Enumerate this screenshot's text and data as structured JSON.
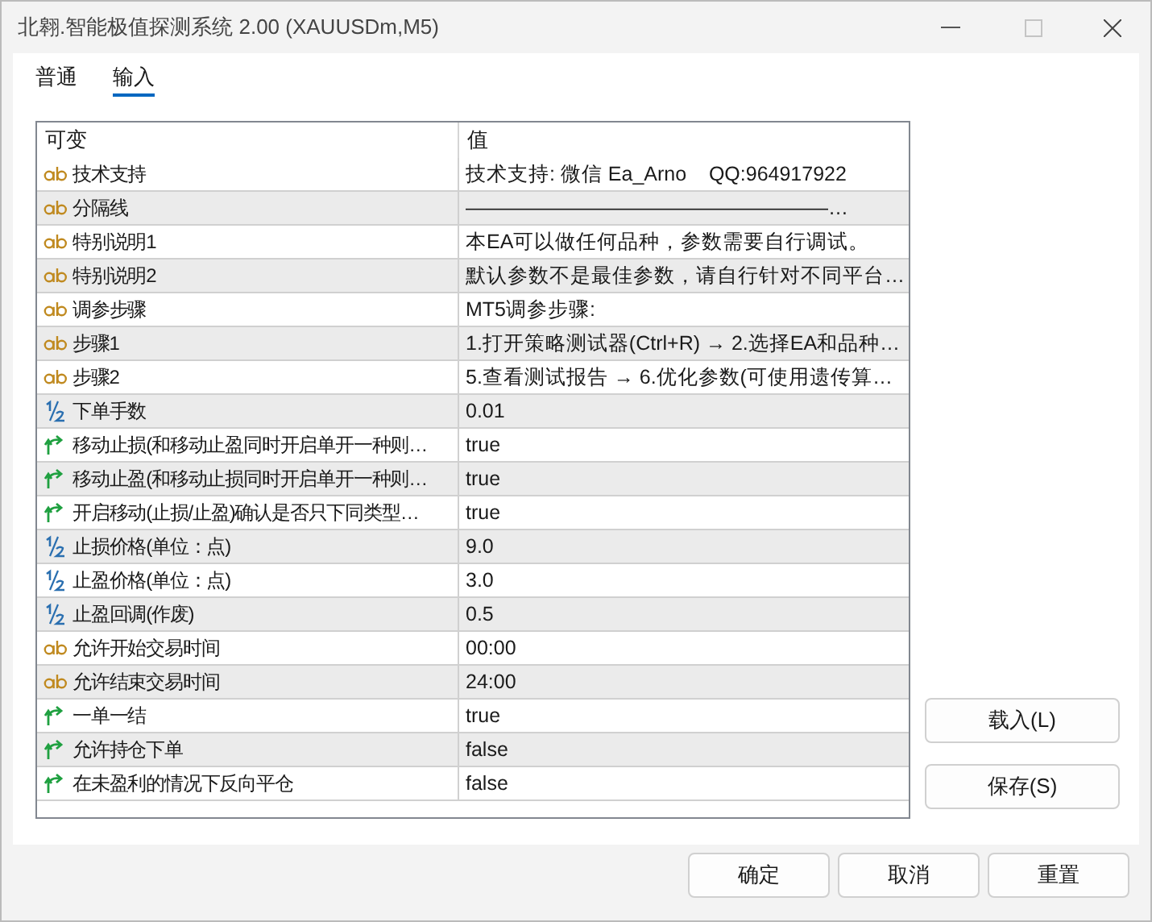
{
  "window": {
    "title": "北翱.智能极值探测系统 2.00 (XAUUSDm,M5)"
  },
  "tabs": [
    {
      "label": "普通",
      "selected": false
    },
    {
      "label": "输入",
      "selected": true
    }
  ],
  "table": {
    "columns": [
      "可变",
      "值"
    ],
    "rows": [
      {
        "kind": "string",
        "name": "技术支持",
        "value": "技术支持: 微信 Ea_Arno    QQ:964917922"
      },
      {
        "kind": "string",
        "name": "分隔线",
        "value": "——————————————————…"
      },
      {
        "kind": "string",
        "name": "特别说明1",
        "value": "本EA可以做任何品种，参数需要自行调试。"
      },
      {
        "kind": "string",
        "name": "特别说明2",
        "value": "默认参数不是最佳参数，请自行针对不同平台…"
      },
      {
        "kind": "string",
        "name": "调参步骤",
        "value": "MT5调参步骤:"
      },
      {
        "kind": "string",
        "name": "步骤1",
        "value": "1.打开策略测试器(Ctrl+R) → 2.选择EA和品种…"
      },
      {
        "kind": "string",
        "name": "步骤2",
        "value": "5.查看测试报告 → 6.优化参数(可使用遗传算…"
      },
      {
        "kind": "double",
        "name": "下单手数",
        "value": "0.01"
      },
      {
        "kind": "bool",
        "name": "移动止损(和移动止盈同时开启单开一种则…",
        "value": "true"
      },
      {
        "kind": "bool",
        "name": "移动止盈(和移动止损同时开启单开一种则…",
        "value": "true"
      },
      {
        "kind": "bool",
        "name": "开启移动(止损/止盈)确认是否只下同类型…",
        "value": "true"
      },
      {
        "kind": "double",
        "name": "止损价格(单位：点)",
        "value": "9.0"
      },
      {
        "kind": "double",
        "name": "止盈价格(单位：点)",
        "value": "3.0"
      },
      {
        "kind": "double",
        "name": "止盈回调(作废)",
        "value": "0.5"
      },
      {
        "kind": "string",
        "name": "允许开始交易时间",
        "value": "00:00"
      },
      {
        "kind": "string",
        "name": "允许结束交易时间",
        "value": "24:00"
      },
      {
        "kind": "bool",
        "name": "一单一结",
        "value": "true"
      },
      {
        "kind": "bool",
        "name": "允许持仓下单",
        "value": "false"
      },
      {
        "kind": "bool",
        "name": "在未盈利的情况下反向平仓",
        "value": "false"
      }
    ]
  },
  "side_buttons": [
    "载入(L)",
    "保存(S)"
  ],
  "buttons": [
    "确定",
    "取消",
    "重置"
  ]
}
